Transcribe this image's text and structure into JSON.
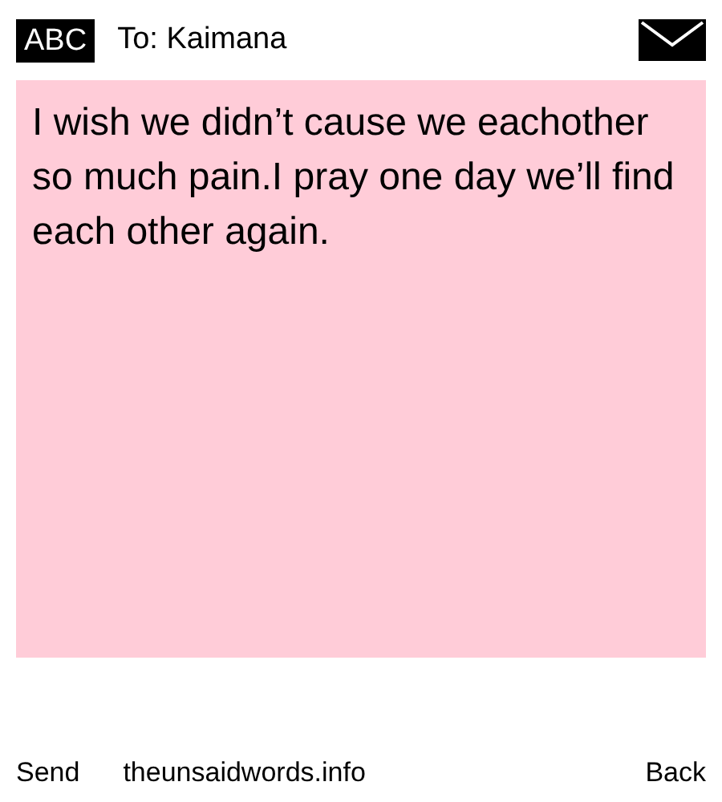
{
  "header": {
    "mode": "ABC",
    "recipient": "To: Kaimana"
  },
  "message": "I wish we didn’t cause we eachother so much pain.I pray one day we’ll find each other again.",
  "footer": {
    "left": "Send",
    "center": "theunsaidwords.info",
    "right": "Back"
  }
}
